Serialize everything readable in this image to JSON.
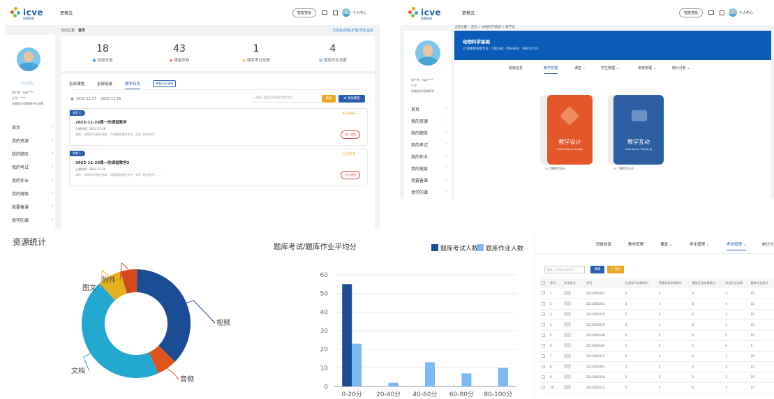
{
  "brand": {
    "logo": "icve",
    "sub": "智慧职教"
  },
  "p1": {
    "app_name": "职教云",
    "smart_btn": "智能答疑",
    "user": "个人中心",
    "breadcrumb_label": "当前位置：",
    "breadcrumb_cur": "首页",
    "top_right_link": "已隐私/隐私护理/学生信息",
    "profile_name": "（已打码）",
    "profile_lines": [
      "用户名：hgx****",
      "工号：****",
      "动物医学/宠物养护与训练"
    ],
    "nav": [
      "首页",
      "我的资源",
      "我的题库",
      "我的考试",
      "我的作业",
      "我的班级",
      "我要备课",
      "我学的课"
    ],
    "stats": [
      {
        "num": "18",
        "label": "班级总数",
        "icon_color": "#2a88d8"
      },
      {
        "num": "43",
        "label": "课堂总数",
        "icon_color": "#e85b3a"
      },
      {
        "num": "1",
        "label": "题库考试总数",
        "icon_color": "#e8a23a"
      },
      {
        "num": "4",
        "label": "题库作业总数",
        "icon_color": "#2a88d8"
      }
    ],
    "tabs": [
      "全部课程",
      "全部班级",
      "教学日历"
    ],
    "tab_badge": "查看日历/课表",
    "date_from": "2022-11-27",
    "date_to": "2022-11-26",
    "search_ph": "请输入要查找的课程/课堂名称",
    "search_btn": "搜索",
    "add_btn": "添加课堂",
    "items": [
      {
        "tag": "课堂 2",
        "status": "已完成",
        "title": "2022-11-26周一的课堂教学",
        "time": "上课时间：2022-11-26",
        "meta": "课程：动物科学基础    班级：22级畜牧兽医专业（1班）跨分班号：......",
        "enter": "进入课堂"
      },
      {
        "tag": "课堂 1",
        "status": "已完成",
        "title": "2022-11-26周一的课堂教学2",
        "time": "上课时间：2022-11-26",
        "meta": "课程：动物科学基础    班级：22级畜牧兽医专业（1班）跨分班号：......",
        "enter": "进入课堂"
      }
    ]
  },
  "p2": {
    "app_name": "职教云",
    "smart_btn": "智能答疑",
    "user": "个人中心",
    "breadcrumb": "当前位置： 首页 > 动物科学基础 > 教学组",
    "course_title": "动物科学基础",
    "course_sub": "22级畜牧兽医专业（1班/3班）跨分班号：SBB16729",
    "tabs": [
      "班级信息",
      "教学管理",
      "课堂",
      "学生管理",
      "考核管理",
      "统计分析"
    ],
    "tab_active": 1,
    "profile_lines": [
      "用户名：hgx****",
      "工号：",
      "动物医学/宠物养护"
    ],
    "nav": [
      "首页",
      "我的资源",
      "我的题库",
      "我的考试",
      "我的作业",
      "我的班级",
      "我要备课",
      "我学的课"
    ],
    "tiles": [
      {
        "title": "教学设计",
        "en": "Instructional Design",
        "link": "了解教学设计",
        "color": "#e3582b"
      },
      {
        "title": "教学互动",
        "en": "Interactive Teaching",
        "link": "了解教学互动",
        "color": "#2f5fa3"
      }
    ]
  },
  "donut": {
    "title": "资源统计",
    "chart_data": {
      "type": "pie",
      "title": "资源统计",
      "labels": [
        "视频",
        "音频",
        "文档",
        "图文",
        "附件"
      ],
      "values": [
        37,
        6,
        45,
        7,
        5
      ],
      "colors": [
        "#1a4d94",
        "#e0541c",
        "#23a9cf",
        "#e3b020",
        "#d44a1c"
      ]
    }
  },
  "bars": {
    "chart_data": {
      "type": "bar",
      "title": "题库考试/题库作业平均分",
      "categories": [
        "0-20分",
        "20-40分",
        "40-60分",
        "60-80分",
        "80-100分"
      ],
      "series": [
        {
          "name": "题库考试人数",
          "values": [
            55,
            0,
            0,
            0,
            0
          ],
          "color": "#1a4d94"
        },
        {
          "name": "题库作业人数",
          "values": [
            23,
            2,
            13,
            7,
            10
          ],
          "color": "#7fb8f3"
        }
      ],
      "ylim": [
        0,
        60
      ],
      "yticks": [
        0,
        10,
        20,
        30,
        40,
        50,
        60
      ]
    }
  },
  "p3": {
    "tabs": [
      "班级信息",
      "教学管理",
      "课堂",
      "学生管理",
      "考核管理",
      "统计分"
    ],
    "tab_active": 4,
    "search_ph": "请输入学生姓名或学号",
    "search_btn": "搜索",
    "export_btn": "导出",
    "headers": [
      "序号",
      "学生姓名",
      "学号",
      "在线学习次数统计",
      "资源阅读次数统计",
      "课堂互动次数统计",
      "考试作业次数",
      "题库作业统计"
    ],
    "rows": [
      [
        "1",
        "",
        "2212000207",
        "5",
        "5",
        "6",
        "3",
        "15"
      ],
      [
        "2",
        "",
        "2212000202",
        "5",
        "5",
        "6",
        "4",
        "15"
      ],
      [
        "3",
        "",
        "2212000225",
        "5",
        "4",
        "6",
        "3",
        "15"
      ],
      [
        "4",
        "",
        "2212000220",
        "5",
        "2",
        "6",
        "3",
        "15"
      ],
      [
        "5",
        "",
        "2212000108",
        "5",
        "2",
        "6",
        "5",
        "15"
      ],
      [
        "6",
        "",
        "2212000105",
        "5",
        "4",
        "5",
        "4",
        "5"
      ],
      [
        "7",
        "",
        "2212000212",
        "5",
        "4",
        "6",
        "3",
        "15"
      ],
      [
        "8",
        "",
        "2212000201",
        "5",
        "5",
        "6",
        "3",
        "15"
      ],
      [
        "9",
        "",
        "2212000226",
        "5",
        "5",
        "5",
        "3",
        "15"
      ],
      [
        "10",
        "",
        "2212000113",
        "5",
        "4",
        "6",
        "3",
        "15"
      ]
    ]
  }
}
